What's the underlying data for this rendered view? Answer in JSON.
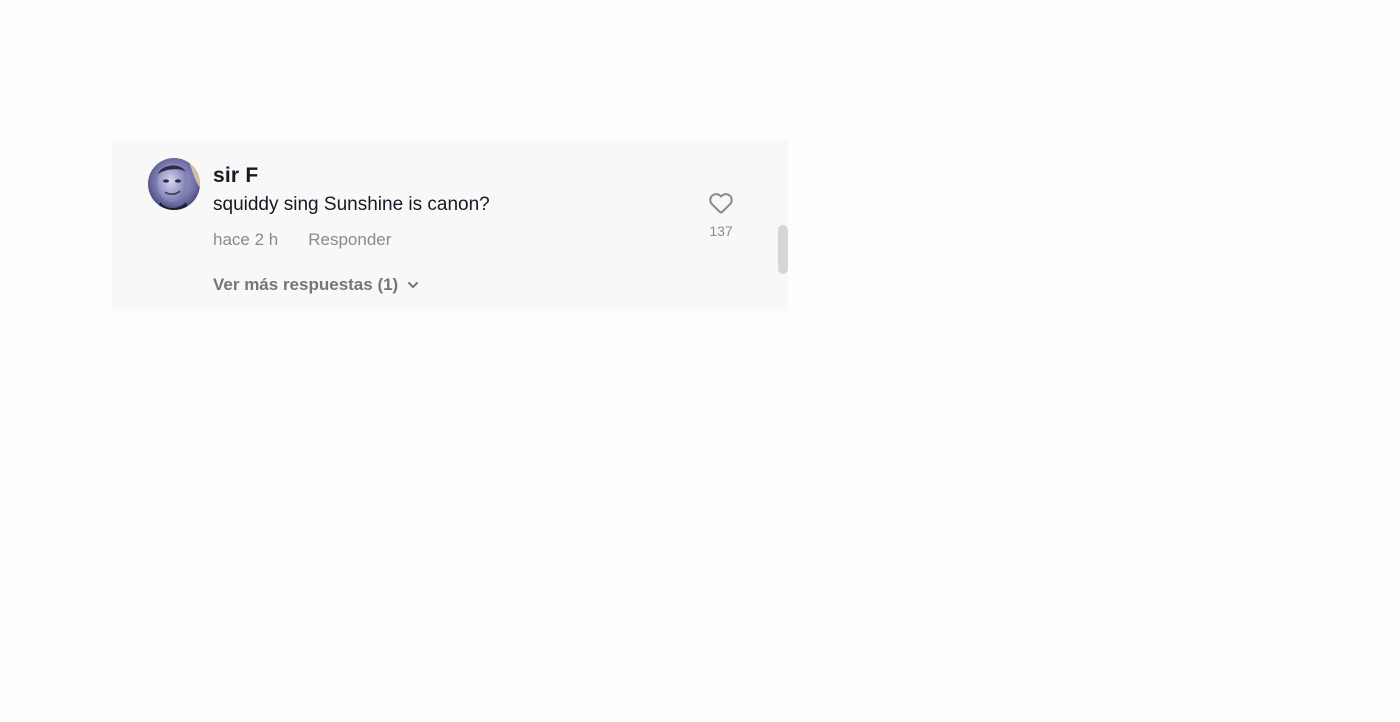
{
  "comment": {
    "username": "sir F",
    "text": "squiddy sing Sunshine is canon?",
    "timestamp": "hace 2 h",
    "reply_label": "Responder",
    "more_replies_label": "Ver más respuestas (1)",
    "like_count": "137",
    "avatar_icon": "avatar-face-image",
    "like_icon": "heart-outline-icon",
    "expand_icon": "chevron-down-icon"
  },
  "colors": {
    "panel_background": "#f8f8f8",
    "primary_text": "#161823",
    "secondary_text": "#8a8b91",
    "scrollbar_thumb": "#d6d6d6"
  }
}
